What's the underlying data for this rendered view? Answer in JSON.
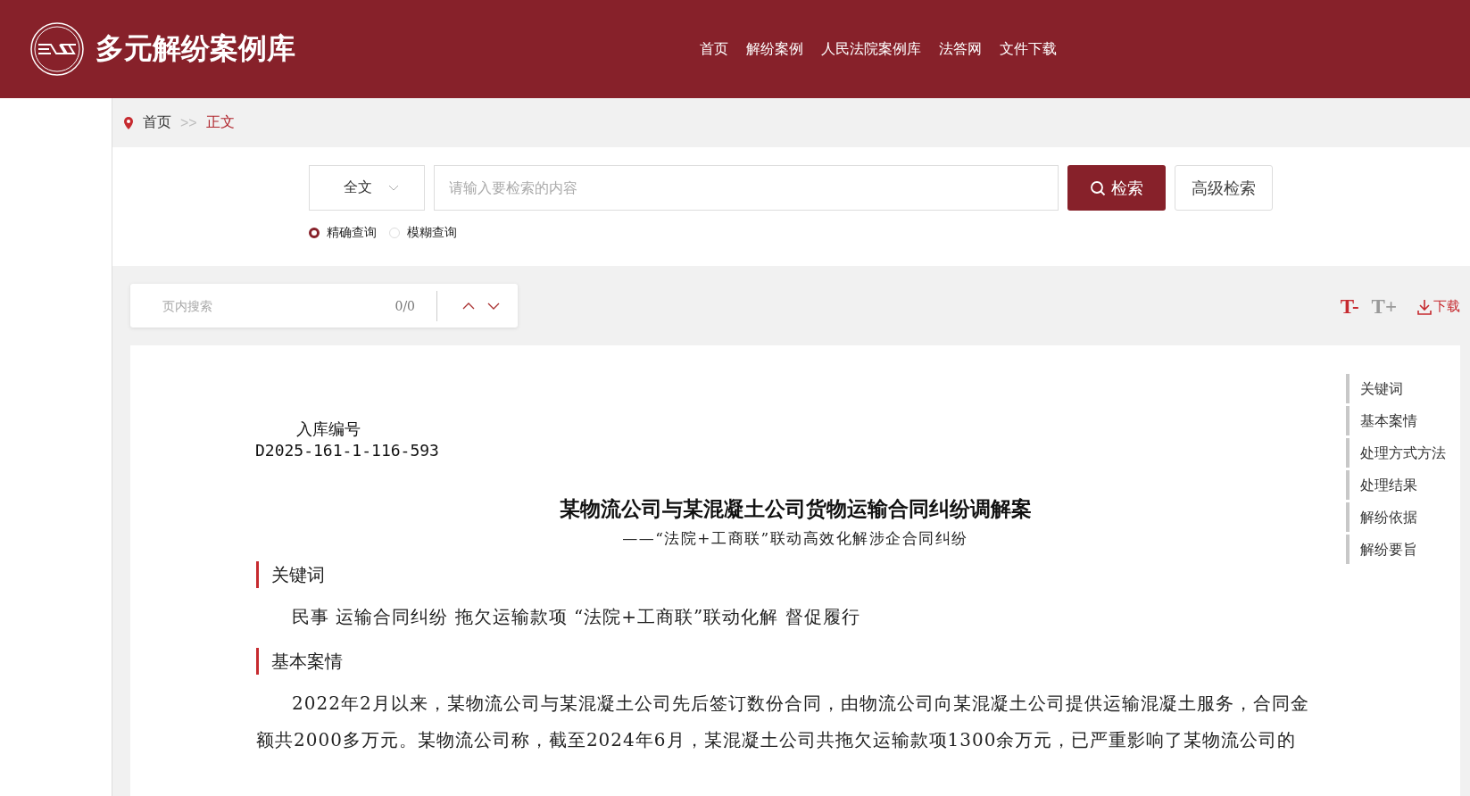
{
  "site": {
    "title": "多元解纷案例库"
  },
  "nav": [
    {
      "label": "首页"
    },
    {
      "label": "解纷案例"
    },
    {
      "label": "人民法院案例库"
    },
    {
      "label": "法答网"
    },
    {
      "label": "文件下载"
    }
  ],
  "breadcrumb": {
    "items": [
      {
        "label": "首页",
        "current": false
      },
      {
        "label": "正文",
        "current": true
      }
    ],
    "separator": ">>"
  },
  "search": {
    "scope": "全文",
    "placeholder": "请输入要检索的内容",
    "button": "检索",
    "advanced": "高级检索",
    "modes": [
      {
        "label": "精确查询",
        "selected": true
      },
      {
        "label": "模糊查询",
        "selected": false
      }
    ]
  },
  "page_search": {
    "placeholder": "页内搜索",
    "count": "0/0"
  },
  "tools": [
    {
      "label": "T-",
      "disabled": false
    },
    {
      "label": "T+",
      "disabled": true
    }
  ],
  "download": {
    "label": "下载"
  },
  "document": {
    "record_label": "入库编号",
    "record_number": "D2025-161-1-116-593",
    "title": "某物流公司与某混凝土公司货物运输合同纠纷调解案",
    "subtitle": "——“法院+工商联”联动高效化解涉企合同纠纷",
    "sections": [
      {
        "heading": "关键词",
        "paragraphs": [
          "民事 运输合同纠纷 拖欠运输款项 “法院+工商联”联动化解 督促履行"
        ]
      },
      {
        "heading": "基本案情",
        "paragraphs": [
          "2022年2月以来，某物流公司与某混凝土公司先后签订数份合同，由物流公司向某混凝土公司提供运输混凝土服务，合同金额共2000多万元。某物流公司称，截至2024年6月，某混凝土公司共拖欠运输款项1300余万元，已严重影响了某物流公司的"
        ]
      }
    ]
  },
  "toc": [
    {
      "label": "关键词"
    },
    {
      "label": "基本案情"
    },
    {
      "label": "处理方式方法"
    },
    {
      "label": "处理结果"
    },
    {
      "label": "解纷依据"
    },
    {
      "label": "解纷要旨"
    }
  ]
}
